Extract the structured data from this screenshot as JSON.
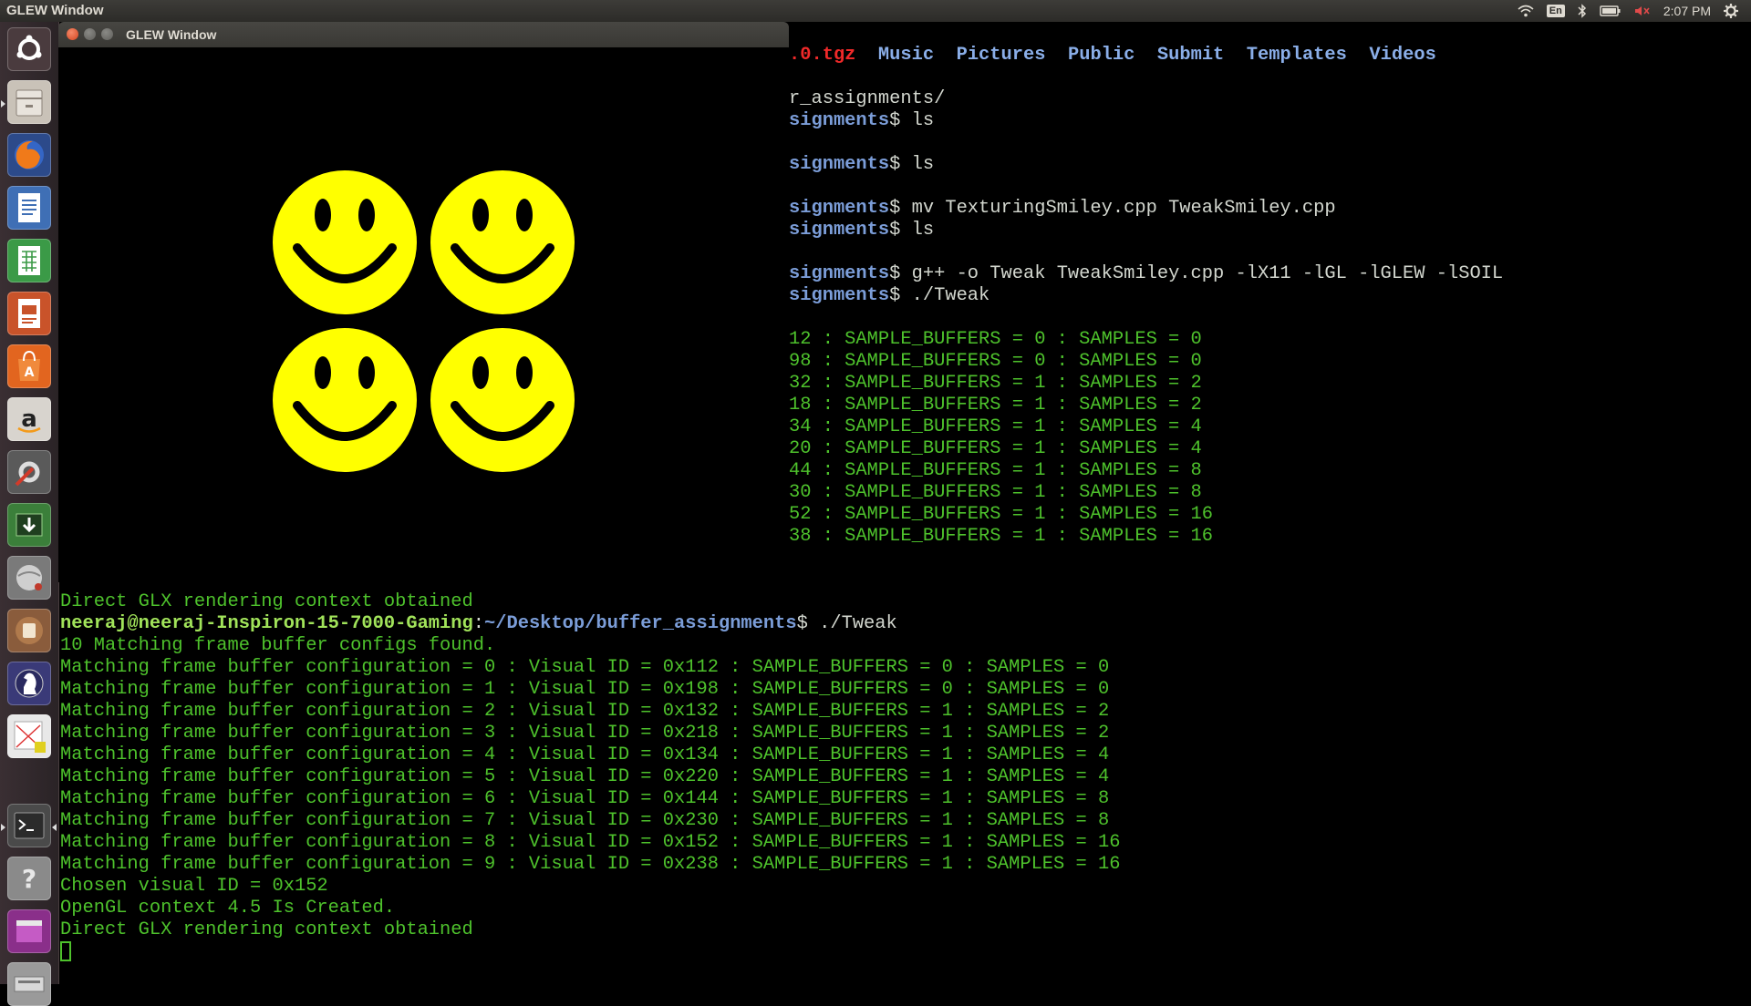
{
  "top_panel": {
    "title": "GLEW Window",
    "keyboard": "En",
    "time": "2:07 PM"
  },
  "glew_window": {
    "title": "GLEW Window"
  },
  "launcher": {
    "items": [
      "dash-home-icon",
      "files-icon",
      "firefox-icon",
      "writer-icon",
      "calc-icon",
      "impress-icon",
      "software-center-icon",
      "amazon-icon",
      "system-settings-icon",
      "update-manager-icon",
      "sphere-app-icon",
      "pot-app-icon",
      "chess-icon",
      "numbers-app-icon",
      "terminal-icon",
      "help-icon",
      "purple-app-icon",
      "scanner-icon"
    ]
  },
  "terminal": {
    "ls_line": {
      "tgz": ".0.tgz",
      "dirs": [
        "Music",
        "Pictures",
        "Public",
        "Submit",
        "Templates",
        "Videos"
      ]
    },
    "upper_lines": [
      {
        "path": "",
        "cmd": "r_assignments/"
      },
      {
        "path": "signments",
        "cmd": " ls"
      },
      {
        "path": "",
        "cmd": ""
      },
      {
        "path": "signments",
        "cmd": " ls"
      },
      {
        "path": "",
        "cmd": ""
      },
      {
        "path": "signments",
        "cmd": " mv TexturingSmiley.cpp TweakSmiley.cpp"
      },
      {
        "path": "signments",
        "cmd": " ls"
      },
      {
        "path": "",
        "cmd": ""
      },
      {
        "path": "signments",
        "cmd": " g++ -o Tweak TweakSmiley.cpp -lX11 -lGL -lGLEW -lSOIL"
      },
      {
        "path": "signments",
        "cmd": " ./Tweak"
      },
      {
        "path": "",
        "cmd": ""
      },
      {
        "path": "",
        "cmd": "12 : SAMPLE_BUFFERS = 0 : SAMPLES = 0"
      },
      {
        "path": "",
        "cmd": "98 : SAMPLE_BUFFERS = 0 : SAMPLES = 0"
      },
      {
        "path": "",
        "cmd": "32 : SAMPLE_BUFFERS = 1 : SAMPLES = 2"
      },
      {
        "path": "",
        "cmd": "18 : SAMPLE_BUFFERS = 1 : SAMPLES = 2"
      },
      {
        "path": "",
        "cmd": "34 : SAMPLE_BUFFERS = 1 : SAMPLES = 4"
      },
      {
        "path": "",
        "cmd": "20 : SAMPLE_BUFFERS = 1 : SAMPLES = 4"
      },
      {
        "path": "",
        "cmd": "44 : SAMPLE_BUFFERS = 1 : SAMPLES = 8"
      },
      {
        "path": "",
        "cmd": "30 : SAMPLE_BUFFERS = 1 : SAMPLES = 8"
      },
      {
        "path": "",
        "cmd": "52 : SAMPLE_BUFFERS = 1 : SAMPLES = 16"
      },
      {
        "path": "",
        "cmd": "38 : SAMPLE_BUFFERS = 1 : SAMPLES = 16"
      }
    ],
    "prev_output": "Direct GLX rendering context obtained",
    "prompt": {
      "user": "neeraj@neeraj-Inspiron-15-7000-Gaming",
      "sep": ":",
      "path": "~/Desktop/buffer_assignments",
      "dollar": "$",
      "cmd": " ./Tweak"
    },
    "output": [
      "10 Matching frame buffer configs found.",
      "Matching frame buffer configuration = 0 : Visual ID = 0x112 : SAMPLE_BUFFERS = 0 : SAMPLES = 0",
      "Matching frame buffer configuration = 1 : Visual ID = 0x198 : SAMPLE_BUFFERS = 0 : SAMPLES = 0",
      "Matching frame buffer configuration = 2 : Visual ID = 0x132 : SAMPLE_BUFFERS = 1 : SAMPLES = 2",
      "Matching frame buffer configuration = 3 : Visual ID = 0x218 : SAMPLE_BUFFERS = 1 : SAMPLES = 2",
      "Matching frame buffer configuration = 4 : Visual ID = 0x134 : SAMPLE_BUFFERS = 1 : SAMPLES = 4",
      "Matching frame buffer configuration = 5 : Visual ID = 0x220 : SAMPLE_BUFFERS = 1 : SAMPLES = 4",
      "Matching frame buffer configuration = 6 : Visual ID = 0x144 : SAMPLE_BUFFERS = 1 : SAMPLES = 8",
      "Matching frame buffer configuration = 7 : Visual ID = 0x230 : SAMPLE_BUFFERS = 1 : SAMPLES = 8",
      "Matching frame buffer configuration = 8 : Visual ID = 0x152 : SAMPLE_BUFFERS = 1 : SAMPLES = 16",
      "Matching frame buffer configuration = 9 : Visual ID = 0x238 : SAMPLE_BUFFERS = 1 : SAMPLES = 16",
      "Chosen visual ID = 0x152",
      "OpenGL context 4.5 Is Created.",
      "Direct GLX rendering context obtained"
    ]
  },
  "colors": {
    "smiley": "#ffff00",
    "terminal_green": "#4ec22c",
    "prompt_user": "#a1e35a",
    "prompt_path": "#7b9dd8",
    "archive_red": "#ef2929"
  }
}
